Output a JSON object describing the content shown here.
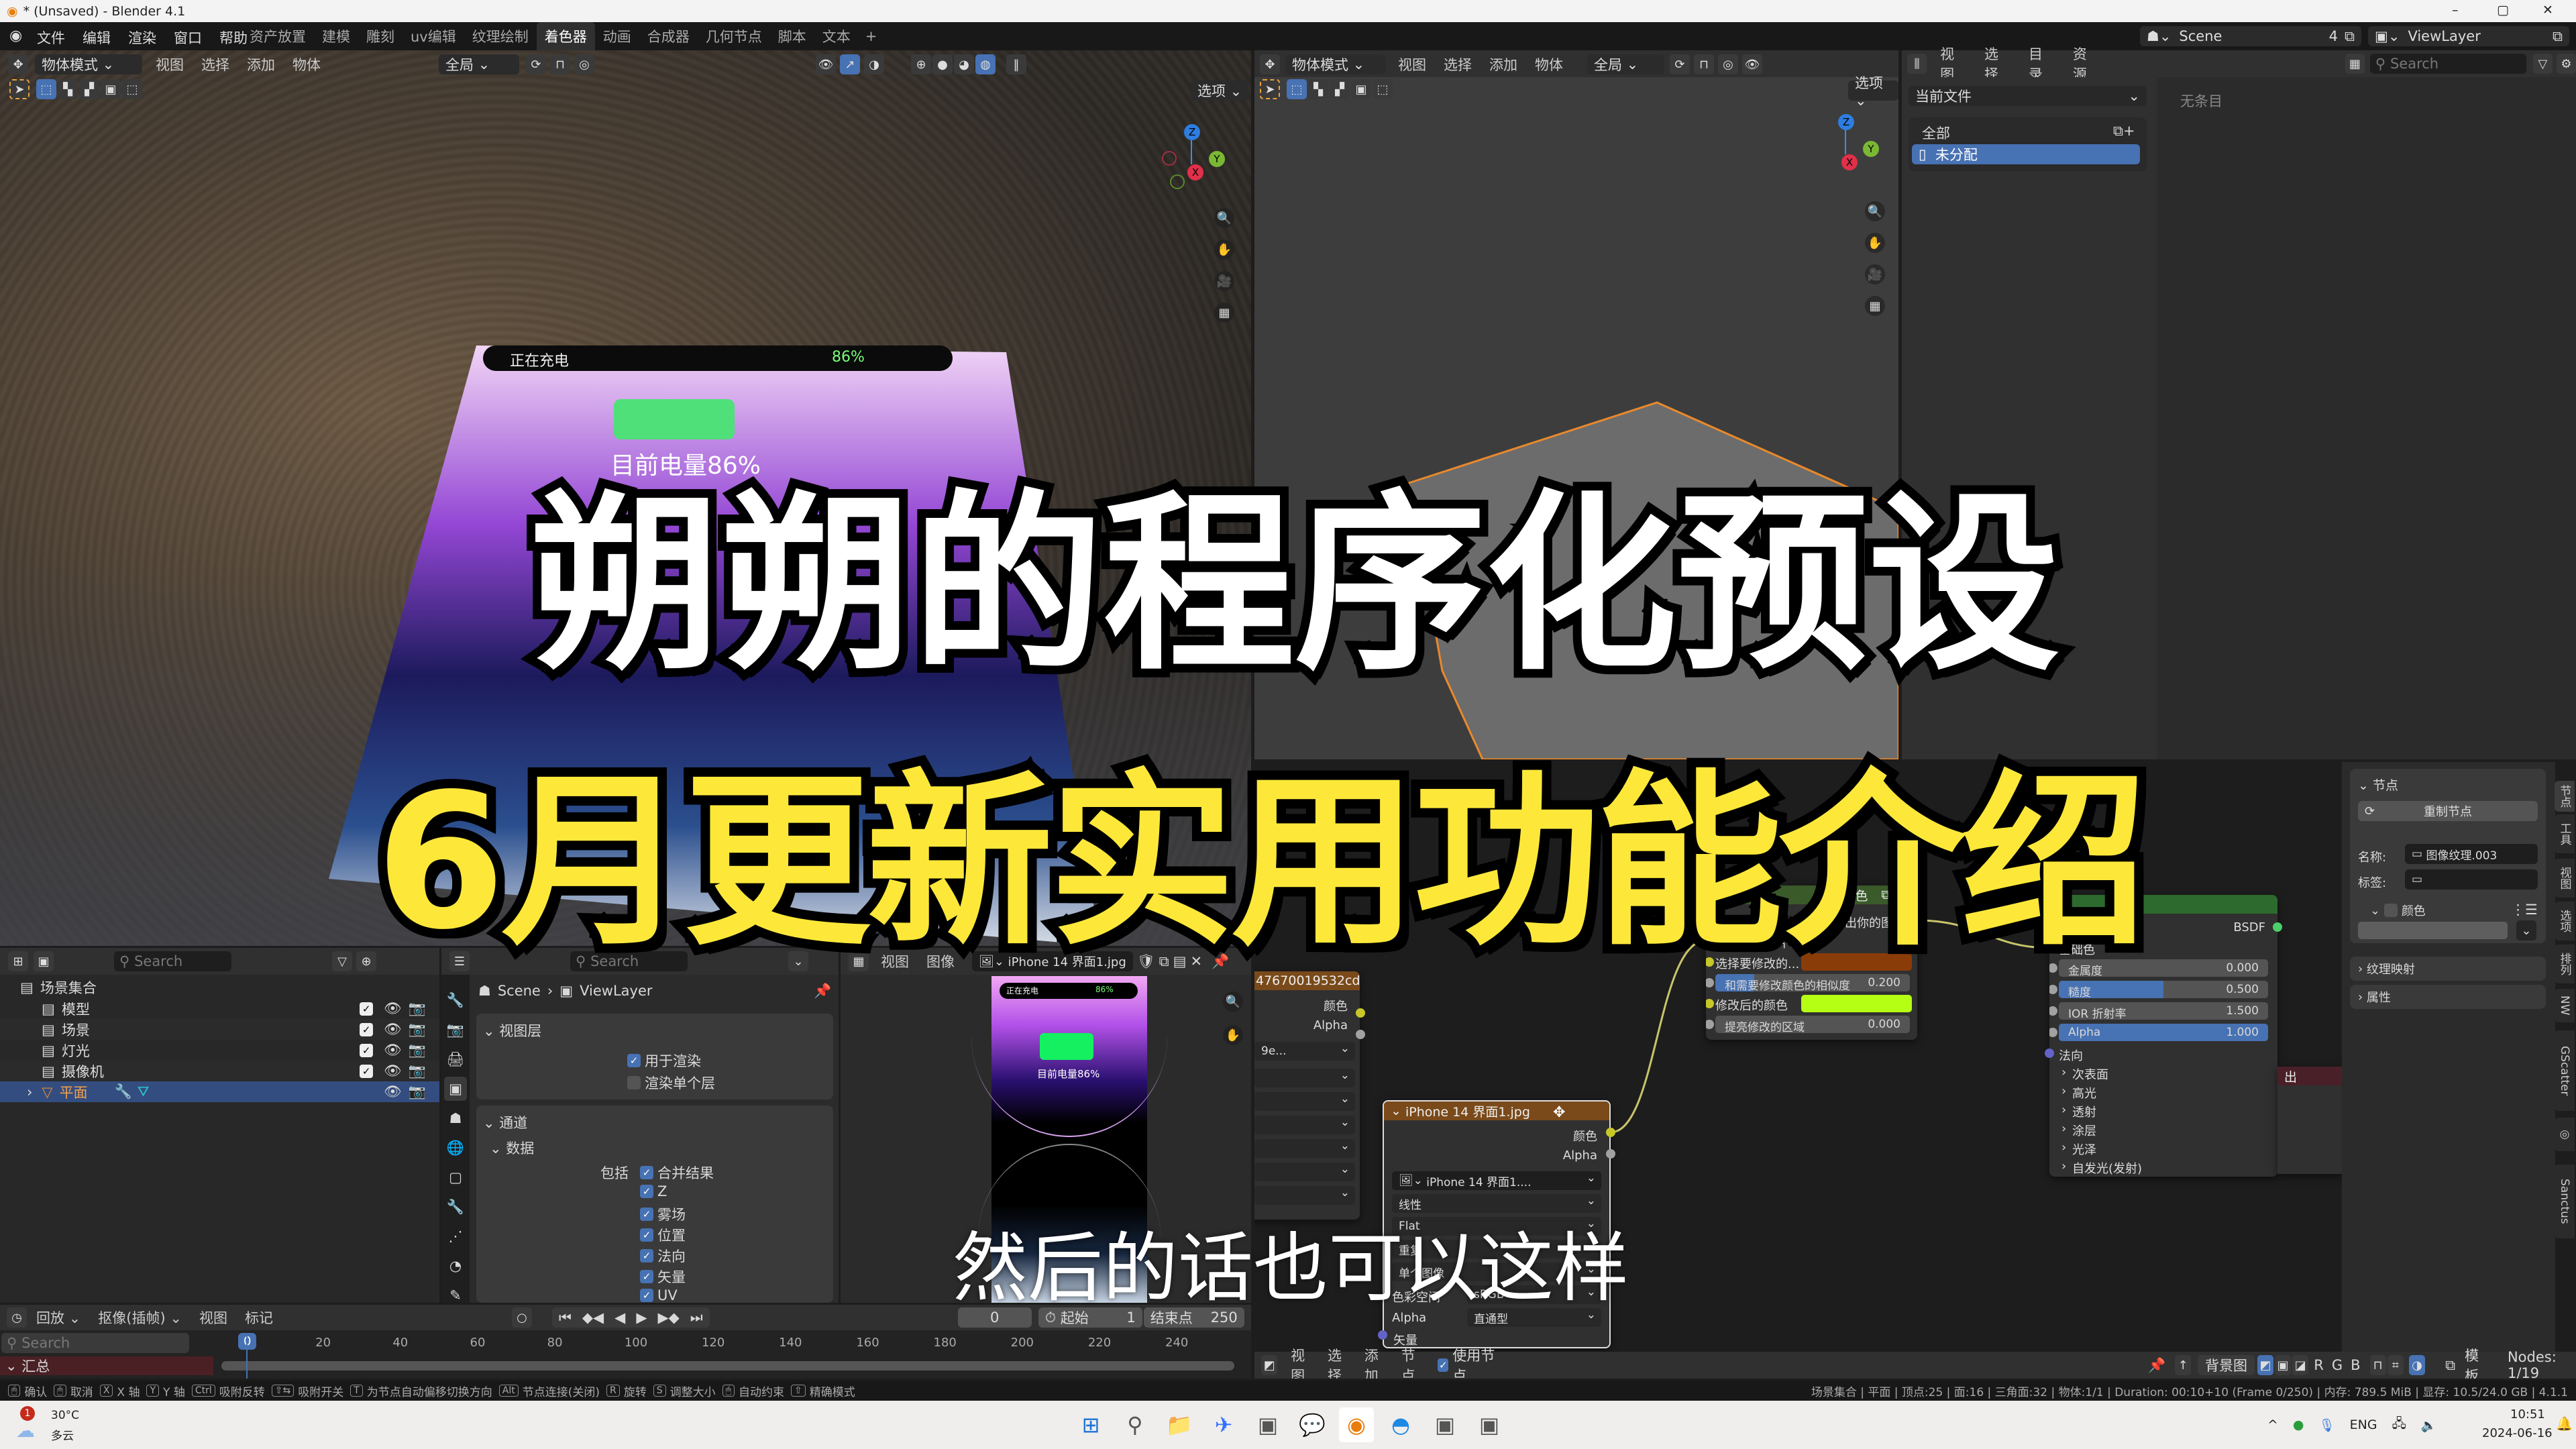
{
  "window": {
    "title": "* (Unsaved) - Blender 4.1",
    "minimize": "–",
    "maximize": "▢",
    "close": "✕"
  },
  "menubar": {
    "menus": [
      "文件",
      "编辑",
      "渲染",
      "窗口",
      "帮助"
    ],
    "workspaces": [
      "资产放置",
      "建模",
      "雕刻",
      "uv编辑",
      "纹理绘制",
      "着色器",
      "动画",
      "合成器",
      "几何节点",
      "脚本",
      "文本"
    ],
    "active_workspace": "着色器",
    "add": "+",
    "scene": "Scene",
    "scene_users": "4",
    "view_layer": "ViewLayer"
  },
  "viewport_left": {
    "mode": "物体模式",
    "menus": [
      "视图",
      "选择",
      "添加",
      "物体"
    ],
    "transform": "全局",
    "options": "选项 ⌄",
    "gizmo": {
      "x": "X",
      "y": "Y",
      "z": "Z"
    }
  },
  "viewport_right": {
    "mode": "物体模式",
    "menus": [
      "视图",
      "选择",
      "添加",
      "物体"
    ],
    "transform": "全局",
    "options": "选项 ⌄",
    "gizmo": {
      "x": "X",
      "y": "Y",
      "z": "Z"
    }
  },
  "phone_screen": {
    "status": "正在充电",
    "percent": "86%",
    "caption": "目前电量86%"
  },
  "asset_browser": {
    "menus": [
      "视图",
      "选择",
      "目录",
      "资源"
    ],
    "search_placeholder": "Search",
    "library": "当前文件",
    "catalogs": [
      "全部",
      "未分配"
    ],
    "selected_catalog": "未分配",
    "empty": "无条目"
  },
  "overlay": {
    "title": "朔朔的程序化预设",
    "subtitle": "6月更新实用功能介绍",
    "caption": "然后的话也可以这样",
    "title_color": "#ffffff",
    "subtitle_color": "#fde83a"
  },
  "outliner": {
    "search_placeholder": "Search",
    "root": "场景集合",
    "items": [
      {
        "label": "模型",
        "selected": false
      },
      {
        "label": "场景",
        "selected": false
      },
      {
        "label": "灯光",
        "selected": false
      },
      {
        "label": "摄像机",
        "selected": false
      },
      {
        "label": "平面",
        "selected": true
      }
    ]
  },
  "properties": {
    "search_placeholder": "Search",
    "breadcrumb": [
      "Scene",
      "ViewLayer"
    ],
    "view_layer": {
      "title": "视图层",
      "use_for_render": "用于渲染",
      "render_single": "渲染单个层"
    },
    "passes": {
      "title": "通道",
      "data": "数据",
      "include": "包括",
      "items": [
        "合并结果",
        "Z",
        "雾场",
        "位置",
        "法向",
        "矢量",
        "UV"
      ]
    }
  },
  "image_editor": {
    "menus": [
      "视图",
      "图像"
    ],
    "image": "iPhone 14 界面1.jpg"
  },
  "timeline": {
    "menus": [
      "回放 ⌄",
      "抠像(插帧) ⌄",
      "视图",
      "标记"
    ],
    "current_frame": "0",
    "start_label": "起始",
    "start": "1",
    "end_label": "结束点",
    "end": "250",
    "search_placeholder": "Search",
    "ticks": [
      0,
      20,
      40,
      60,
      80,
      100,
      120,
      140,
      160,
      180,
      200,
      220,
      240
    ],
    "summary": "汇总"
  },
  "node_editor": {
    "menus": [
      "视图",
      "选择",
      "添加",
      "节点"
    ],
    "use_nodes": "使用节点",
    "backdrop": "背景图",
    "channels": [
      "R",
      "G",
      "B"
    ],
    "template": "模板",
    "node_count": "Nodes: 1/19",
    "nodes": {
      "left_image": {
        "title": "47670019532cdc4...",
        "outputs": [
          "颜色",
          "Alpha"
        ],
        "image": "9e..."
      },
      "image_texture": {
        "title": "iPhone 14 界面1.jpg",
        "outputs": [
          "颜色",
          "Alpha"
        ],
        "image": "iPhone 14 界面1....",
        "interpolation": "线性",
        "projection": "Flat",
        "extension": "重复",
        "source": "单个图像",
        "colorspace_label": "色彩空间",
        "colorspace": "sRGB",
        "alpha_label": "Alpha",
        "alpha": "直通型",
        "vector": "矢量"
      },
      "group": {
        "title_fragment": "色",
        "output": "输出你的图片",
        "inputs": [
          {
            "label": "输入你的图片"
          },
          {
            "label": "选择要修改的...",
            "color": "#8a3c08"
          },
          {
            "label": "和需要修改颜色的相似度",
            "value": "0.200",
            "fill": 0.2
          },
          {
            "label": "修改后的颜色",
            "color": "#b5ff14"
          },
          {
            "label": "提亮修改的区域",
            "value": "0.000",
            "fill": 0
          }
        ]
      },
      "bsdf": {
        "output": "BSDF",
        "base_color": "基础色",
        "sliders": [
          {
            "label": "金属度",
            "value": "0.000",
            "fill": 0
          },
          {
            "label": "糙度",
            "value": "0.500",
            "fill": 0.5
          },
          {
            "label": "IOR 折射率",
            "value": "1.500",
            "fill": 0
          },
          {
            "label": "Alpha",
            "value": "1.000",
            "fill": 1
          }
        ],
        "normal": "法向",
        "subpanels": [
          "次表面",
          "高光",
          "透射",
          "涂层",
          "光泽",
          "自发光(发射)"
        ]
      },
      "output": {
        "title_fragment": "出"
      }
    },
    "sidebar": {
      "panel": "节点",
      "reset": "重制节点",
      "name_label": "名称:",
      "name": "图像纹理.003",
      "label_label": "标签:",
      "label": "",
      "color": "颜色",
      "texture_mapping": "纹理映射",
      "properties": "属性",
      "tabs": [
        "节点",
        "工具",
        "视图",
        "选项",
        "排列",
        "NW",
        "GScatter",
        "Sanctus"
      ]
    }
  },
  "statusbar": {
    "keymap": [
      {
        "key": "🖱",
        "label": "确认"
      },
      {
        "key": "🖱",
        "label": "取消"
      },
      {
        "key": "X",
        "label": "X 轴"
      },
      {
        "key": "Y",
        "label": "Y 轴"
      },
      {
        "key": "Ctrl",
        "label": "吸附反转"
      },
      {
        "key": "⇧⇆",
        "label": "吸附开关"
      },
      {
        "key": "T",
        "label": "为节点自动偏移切换方向"
      },
      {
        "key": "Alt",
        "label": "节点连接(关闭)"
      },
      {
        "key": "R",
        "label": "旋转"
      },
      {
        "key": "S",
        "label": "调整大小"
      },
      {
        "key": "🖱",
        "label": "自动约束"
      },
      {
        "key": "⇧",
        "label": "精确模式"
      }
    ],
    "stats": "场景集合 | 平面 | 顶点:25 | 面:16 | 三角面:32 | 物体:1/1 | Duration: 00:10+10 (Frame 0/250) | 内存: 789.5 MiB | 显存: 10.5/24.0 GB | 4.1.1"
  },
  "taskbar": {
    "weather_badge": "1",
    "weather_temp": "30°C",
    "weather_desc": "多云",
    "lang": "ENG",
    "time": "10:51",
    "date": "2024-06-16",
    "apps": [
      "start-icon",
      "search-icon",
      "file-explorer-icon",
      "feishu-icon",
      "app-icon",
      "wechat-icon",
      "blender-icon",
      "edge-icon",
      "app-icon",
      "app-icon"
    ]
  }
}
